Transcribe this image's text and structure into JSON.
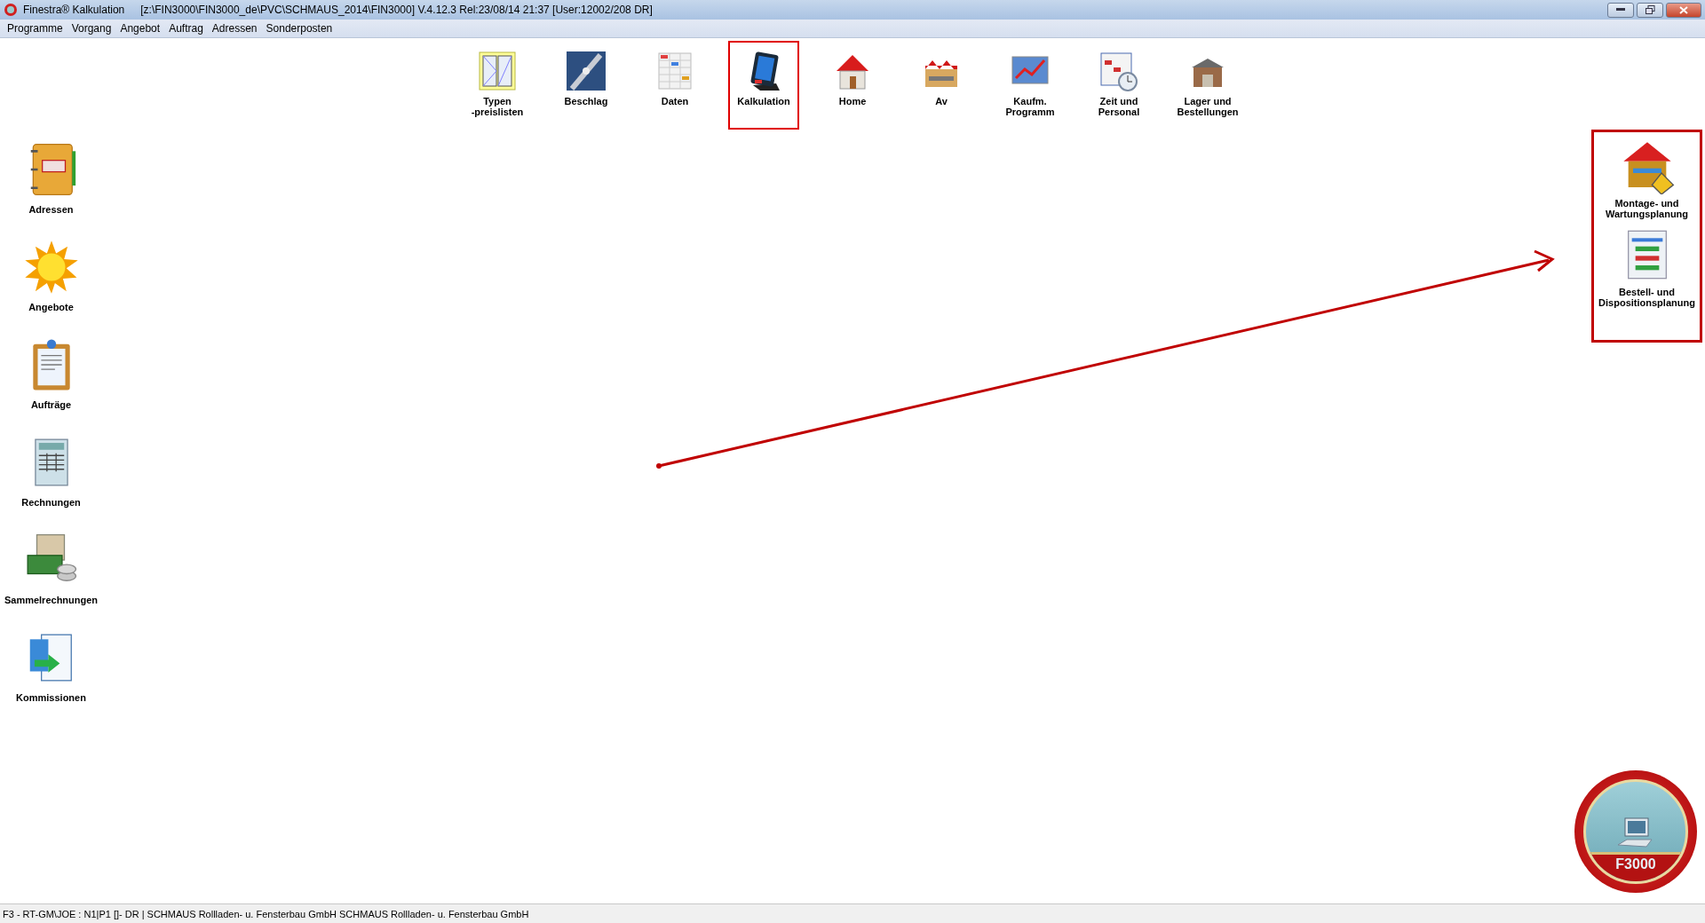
{
  "window": {
    "app_title": "Finestra® Kalkulation",
    "info": "[z:\\FIN3000\\FIN3000_de\\PVC\\SCHMAUS_2014\\FIN3000] V.4.12.3 Rel:23/08/14 21:37 [User:12002/208 DR]"
  },
  "menu": [
    "Programme",
    "Vorgang",
    "Angebot",
    "Auftrag",
    "Adressen",
    "Sonderposten"
  ],
  "toolbar": [
    {
      "label": "Typen\n-preislisten",
      "kind": "window",
      "highlighted": false
    },
    {
      "label": "Beschlag",
      "kind": "fitting",
      "highlighted": false
    },
    {
      "label": "Daten",
      "kind": "data",
      "highlighted": false
    },
    {
      "label": "Kalkulation",
      "kind": "calculator",
      "highlighted": true
    },
    {
      "label": "Home",
      "kind": "house",
      "highlighted": false
    },
    {
      "label": "Av",
      "kind": "factory",
      "highlighted": false
    },
    {
      "label": "Kaufm.\nProgramm",
      "kind": "chart",
      "highlighted": false
    },
    {
      "label": "Zeit und\nPersonal",
      "kind": "clock",
      "highlighted": false
    },
    {
      "label": "Lager und\nBestellungen",
      "kind": "warehouse",
      "highlighted": false
    }
  ],
  "sidebar": [
    {
      "label": "Adressen",
      "kind": "book"
    },
    {
      "label": "Angebote",
      "kind": "sun"
    },
    {
      "label": "Aufträge",
      "kind": "clipboard"
    },
    {
      "label": "Rechnungen",
      "kind": "invoice"
    },
    {
      "label": "Sammelrechnungen",
      "kind": "money"
    },
    {
      "label": "Kommissionen",
      "kind": "transfer"
    }
  ],
  "right_panel": {
    "highlighted": true,
    "items": [
      {
        "label": "Montage- und\nWartungsplanung",
        "kind": "site"
      },
      {
        "label": "Bestell- und\nDispositionsplanung",
        "kind": "plan"
      }
    ]
  },
  "logo": {
    "text": "F3000"
  },
  "status_bar": "F3 - RT-GM\\JOE : N1|P1 []- DR | SCHMAUS Rollladen- u. Fensterbau GmbH SCHMAUS Rollladen- u. Fensterbau GmbH"
}
